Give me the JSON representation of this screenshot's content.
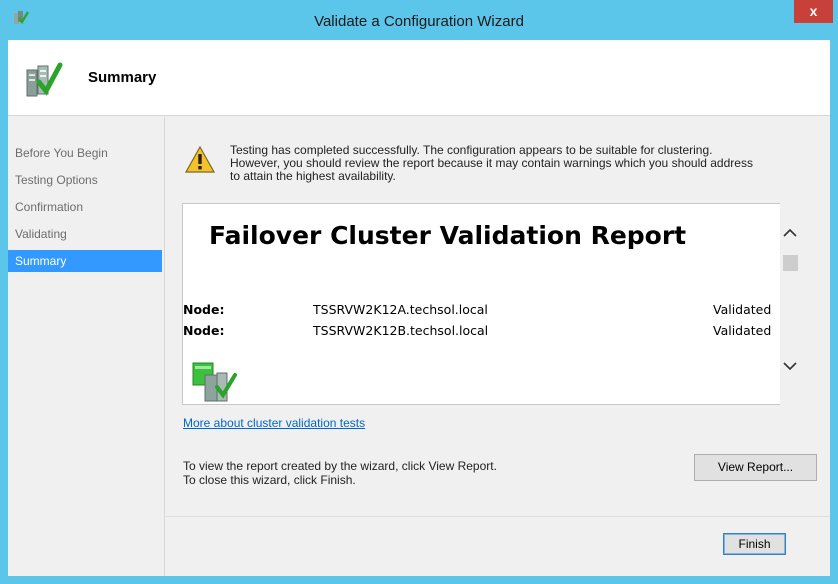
{
  "window": {
    "title": "Validate a Configuration Wizard",
    "close_label": "x",
    "app_icon": "cluster-validation-icon"
  },
  "header": {
    "title": "Summary",
    "icon": "cluster-check-icon"
  },
  "sidebar": {
    "items": [
      {
        "label": "Before You Begin",
        "active": false
      },
      {
        "label": "Testing Options",
        "active": false
      },
      {
        "label": "Confirmation",
        "active": false
      },
      {
        "label": "Validating",
        "active": false
      },
      {
        "label": "Summary",
        "active": true
      }
    ]
  },
  "main": {
    "message_line1": "Testing has completed successfully. The configuration appears to be suitable for clustering.",
    "message_line2": "However, you should review the report because it may contain warnings which you should address",
    "message_line3": "to attain the highest availability.",
    "warning_icon": "warning-icon",
    "report": {
      "title": "Failover Cluster Validation Report",
      "nodes": [
        {
          "label": "Node:",
          "name": "TSSRVW2K12A.techsol.local",
          "status": "Validated"
        },
        {
          "label": "Node:",
          "name": "TSSRVW2K12B.techsol.local",
          "status": "Validated"
        }
      ]
    },
    "link_text": "More about cluster validation tests",
    "instruction_line1": "To view the report created by the wizard, click View Report.",
    "instruction_line2": "To close this wizard, click Finish.",
    "view_report_label": "View Report...",
    "finish_label": "Finish"
  },
  "colors": {
    "titlebar": "#5bc5ea",
    "close": "#c7413a",
    "selection": "#3399ff",
    "link": "#0066cc"
  }
}
